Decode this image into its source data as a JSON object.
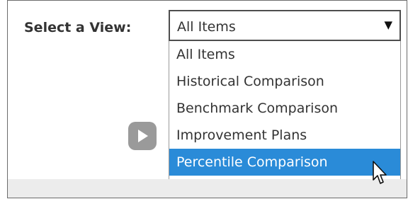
{
  "select_view": {
    "label": "Select a View:",
    "selected_value": "All Items",
    "options": [
      {
        "label": "All Items"
      },
      {
        "label": "Historical Comparison"
      },
      {
        "label": "Benchmark Comparison"
      },
      {
        "label": "Improvement Plans"
      },
      {
        "label": "Percentile Comparison"
      }
    ],
    "highlighted_option": "Percentile Comparison"
  },
  "icons": {
    "caret": "caret-down-icon",
    "play": "play-icon",
    "cursor": "mouse-pointer-icon"
  },
  "colors": {
    "highlight": "#2a8bd8",
    "text": "#333333",
    "play_button": "#9a9a9a"
  }
}
